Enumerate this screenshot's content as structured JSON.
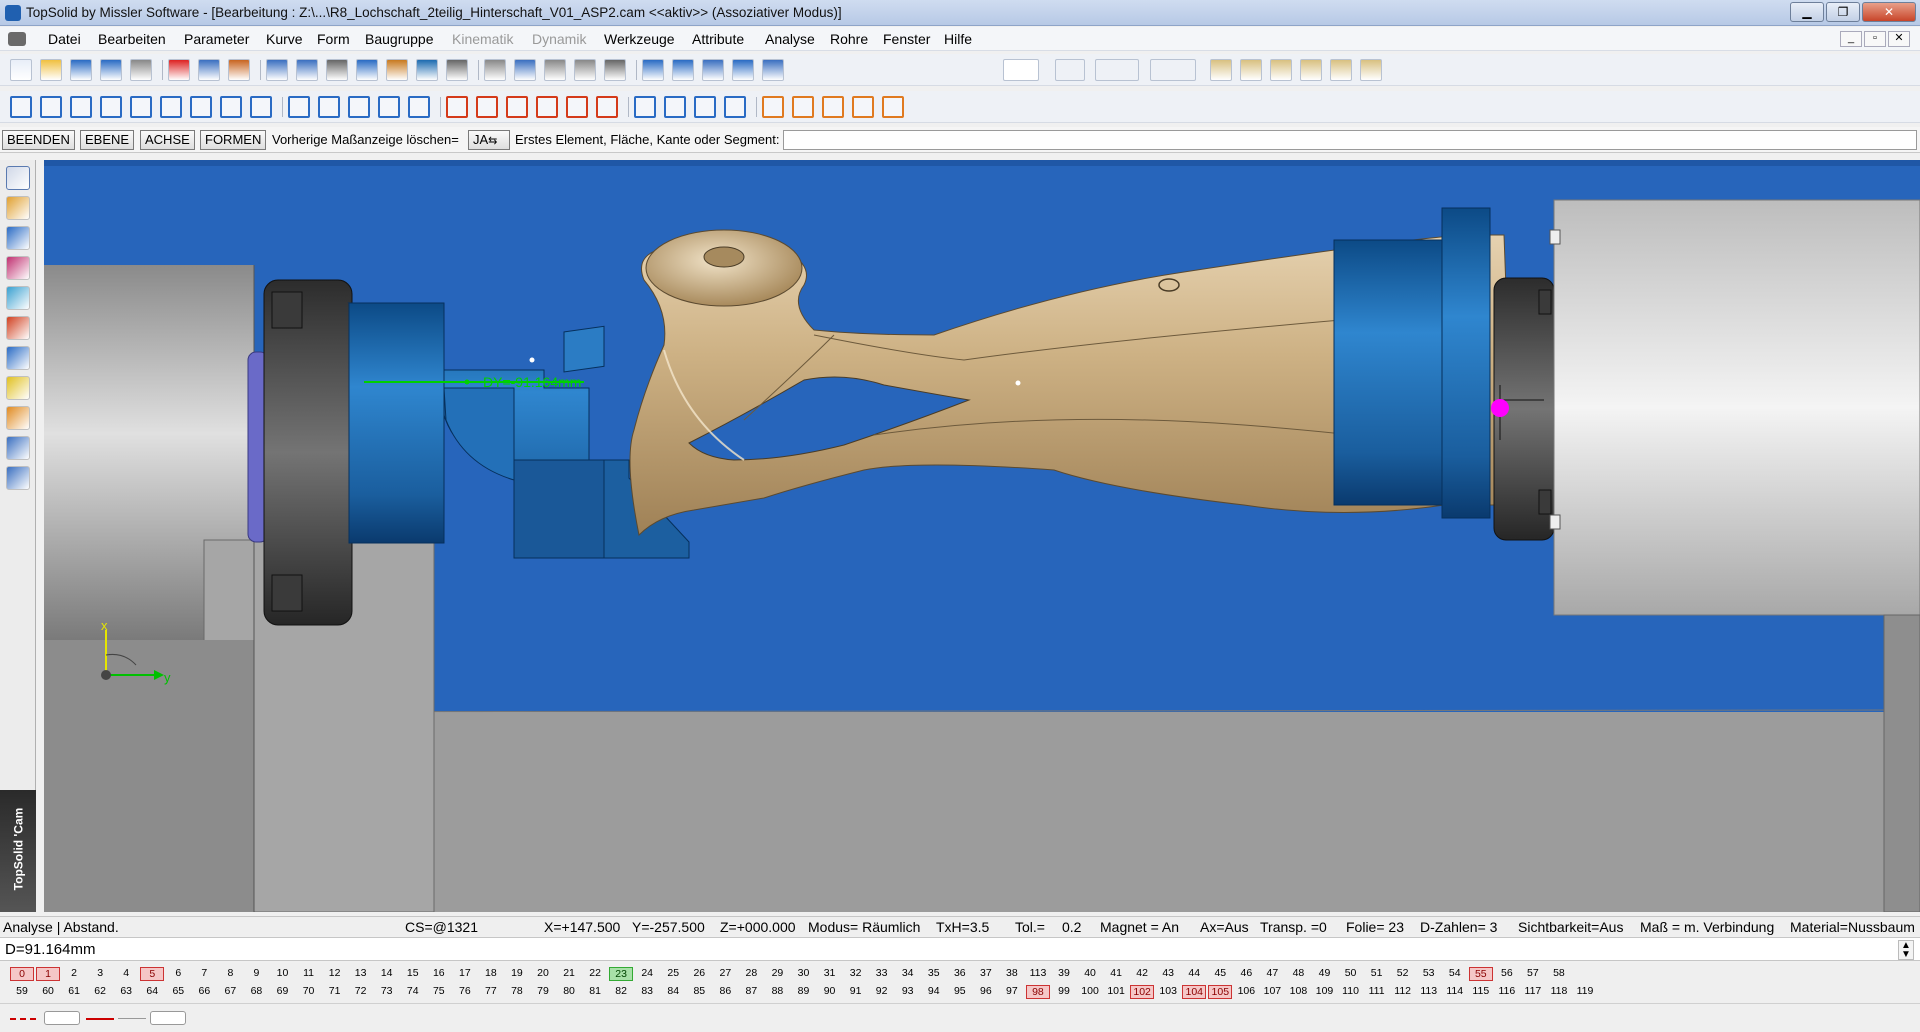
{
  "window": {
    "title": "TopSolid by Missler Software - [Bearbeitung : Z:\\...\\R8_Lochschaft_2teilig_Hinterschaft_V01_ASP2.cam    <<aktiv>> (Assoziativer Modus)]",
    "buttons": [
      "▁",
      "❐",
      "✕"
    ],
    "doc_buttons": [
      "_",
      "▫",
      "✕"
    ]
  },
  "menu": [
    {
      "label": "Datei",
      "enabled": true
    },
    {
      "label": "Bearbeiten",
      "enabled": true
    },
    {
      "label": "Parameter",
      "enabled": true
    },
    {
      "label": "Kurve",
      "enabled": true
    },
    {
      "label": "Form",
      "enabled": true
    },
    {
      "label": "Baugruppe",
      "enabled": true
    },
    {
      "label": "Kinematik",
      "enabled": false
    },
    {
      "label": "Dynamik",
      "enabled": false
    },
    {
      "label": "Werkzeuge",
      "enabled": true
    },
    {
      "label": "Attribute",
      "enabled": true
    },
    {
      "label": "Analyse",
      "enabled": true
    },
    {
      "label": "Rohre",
      "enabled": true
    },
    {
      "label": "Fenster",
      "enabled": true
    },
    {
      "label": "Hilfe",
      "enabled": true
    }
  ],
  "toolbar1_icons": [
    "new-icon",
    "open-icon",
    "save-icon",
    "properties-icon",
    "print-icon",
    "delete-icon",
    "undo-icon",
    "eraser-icon",
    "refresh-icon",
    "render-icon",
    "sliders-icon",
    "hammer-icon",
    "cog-icon",
    "sphere-icon",
    "magnet-icon",
    "select-icon",
    "trim-icon",
    "pipes-icon",
    "rotate-icon",
    "options-icon",
    "zoom-icon",
    "frame-icon",
    "move-icon",
    "car-icon",
    "drill-icon"
  ],
  "toolbar2_icons": [
    "sketch-icon",
    "constraint-icon",
    "line-icon",
    "circle-target-icon",
    "rectangle-icon",
    "grid-icon",
    "corner-icon",
    "ellipse-icon",
    "hexagon-icon",
    "parallel-icon",
    "point-icon",
    "slot-icon",
    "box-icon",
    "spline-icon",
    "fillet-icon",
    "chamfer-icon",
    "offset-icon",
    "arch-icon",
    "hook-icon",
    "curve-icon",
    "scale-icon",
    "project-icon",
    "copy-icon",
    "cancel-icon",
    "stack-icon",
    "layer-icon",
    "sheets-icon",
    "tree-icon",
    "table-icon"
  ],
  "command": {
    "buttons": [
      "BEENDEN",
      "EBENE",
      "ACHSE",
      "FORMEN"
    ],
    "clear_label": "Vorherige Maßanzeige löschen=",
    "clear_value": "JA",
    "prompt": "Erstes Element, Fläche, Kante oder Segment:",
    "input": ""
  },
  "left_tools": [
    "pencil-icon",
    "ruler-icon",
    "cube-icon",
    "flag-icon",
    "wheel-icon",
    "drill-bit-icon",
    "cubes-icon",
    "star-icon",
    "puzzle-icon",
    "machine-icon",
    "assembly-icon"
  ],
  "brand": "TopSolid 'Cam",
  "viewport": {
    "dimension_label": "DY=-91.164mm",
    "axis_x": "x",
    "axis_y": "y",
    "colors": {
      "part": "#c9ad82",
      "fixture": "#1f67a8",
      "background": "#2765bb",
      "floor": "#9c9c9c",
      "dimension": "#00d000"
    }
  },
  "status": {
    "mode": "Analyse | Abstand.",
    "cs": "CS=@1321",
    "x": "X=+147.500",
    "y": "Y=-257.500",
    "z": "Z=+000.000",
    "modus": "Modus= Räumlich",
    "txh": "TxH=3.5",
    "tol_label": "Tol.=",
    "tol_value": "0.2",
    "magnet": "Magnet = An",
    "ax": "Ax=Aus",
    "transp": "Transp. =0",
    "folie": "Folie= 23",
    "dzahlen": "D-Zahlen= 3",
    "sicht": "Sichtbarkeit=Aus",
    "mass": "Maß = m. Verbindung",
    "material": "Material=Nussbaum"
  },
  "input_value": "D=91.164mm",
  "layers_row1": [
    "0",
    "1",
    "2",
    "3",
    "4",
    "5",
    "6",
    "7",
    "8",
    "9",
    "10",
    "11",
    "12",
    "13",
    "14",
    "15",
    "16",
    "17",
    "18",
    "19",
    "20",
    "21",
    "22",
    "23",
    "24",
    "25",
    "26",
    "27",
    "28",
    "29",
    "30",
    "31",
    "32",
    "33",
    "34",
    "35",
    "36",
    "37",
    "38",
    "113",
    "39",
    "40",
    "41",
    "42",
    "43",
    "44",
    "45",
    "46",
    "47",
    "48",
    "49",
    "50",
    "51",
    "52",
    "53",
    "54",
    "55",
    "56",
    "57",
    "58"
  ],
  "layers_row2": [
    "59",
    "60",
    "61",
    "62",
    "63",
    "64",
    "65",
    "66",
    "67",
    "68",
    "69",
    "70",
    "71",
    "72",
    "73",
    "74",
    "75",
    "76",
    "77",
    "78",
    "79",
    "80",
    "81",
    "82",
    "83",
    "84",
    "85",
    "86",
    "87",
    "88",
    "89",
    "90",
    "91",
    "92",
    "93",
    "94",
    "95",
    "96",
    "97",
    "98",
    "99",
    "100",
    "101",
    "102",
    "103",
    "104",
    "105",
    "106",
    "107",
    "108",
    "109",
    "110",
    "111",
    "112",
    "113",
    "114",
    "115",
    "116",
    "117",
    "118",
    "119"
  ],
  "layers_highlight": [
    "0",
    "1",
    "5",
    "55",
    "98",
    "102",
    "104",
    "105"
  ],
  "layers_current": "23"
}
